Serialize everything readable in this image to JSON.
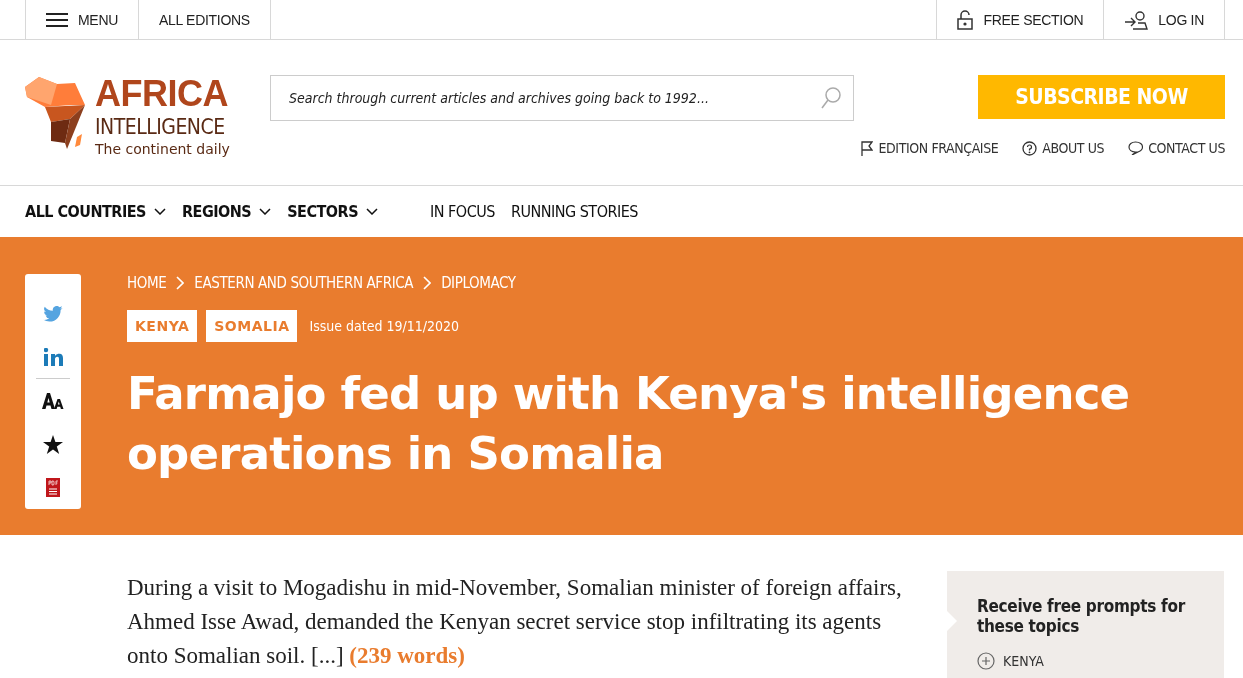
{
  "top_bar": {
    "menu": "MENU",
    "editions": "ALL EDITIONS",
    "free_section": "FREE SECTION",
    "login": "LOG IN"
  },
  "header": {
    "logo": {
      "name": "AFRICA",
      "sub": "INTELLIGENCE",
      "tagline": "The continent daily"
    },
    "search": {
      "placeholder": "Search through current articles and archives going back to 1992..."
    },
    "subscribe": "SUBSCRIBE NOW",
    "links": [
      {
        "kind": "flag",
        "label": "EDITION FRANÇAISE"
      },
      {
        "kind": "help",
        "label": "ABOUT US"
      },
      {
        "kind": "chat",
        "label": "CONTACT US"
      }
    ]
  },
  "nav": [
    {
      "label": "ALL COUNTRIES",
      "dropdown": true
    },
    {
      "label": "REGIONS",
      "dropdown": true
    },
    {
      "label": "SECTORS",
      "dropdown": true
    },
    {
      "label": "IN FOCUS",
      "dropdown": false
    },
    {
      "label": "RUNNING STORIES",
      "dropdown": false
    }
  ],
  "share": [
    {
      "kind": "twitter"
    },
    {
      "kind": "linkedin"
    },
    {
      "kind": "font"
    },
    {
      "kind": "star"
    },
    {
      "kind": "pdf"
    }
  ],
  "breadcrumb": [
    "HOME",
    "EASTERN AND SOUTHERN AFRICA",
    "DIPLOMACY"
  ],
  "tags": [
    "KENYA",
    "SOMALIA"
  ],
  "issue": "Issue dated 19/11/2020",
  "title": "Farmajo fed up with Kenya's intelligence operations in Somalia",
  "summary": "During a visit to Mogadishu in mid-November, Somalian minister of foreign affairs, Ahmed Isse Awad, demanded the Kenyan secret service stop infiltrating its agents onto Somalian soil. [...]",
  "word_count": "(239 words)",
  "alerts": {
    "title": "Receive free prompts for these topics",
    "topics": [
      "KENYA"
    ]
  }
}
